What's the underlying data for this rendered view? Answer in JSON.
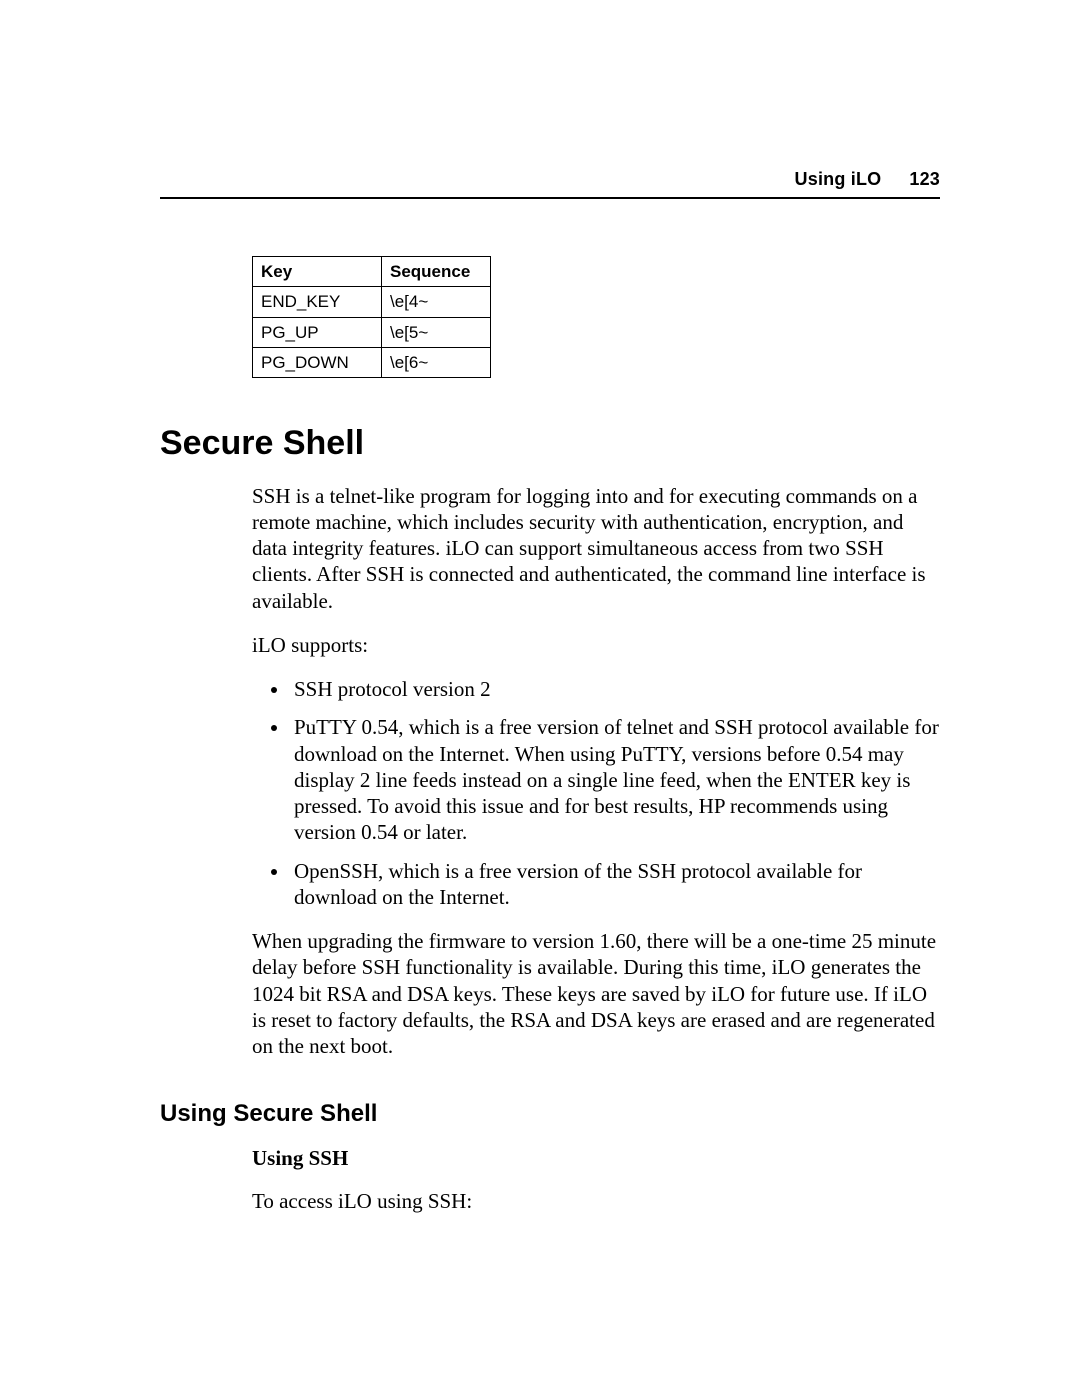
{
  "header": {
    "section": "Using iLO",
    "page_number": "123"
  },
  "table": {
    "headers": {
      "key": "Key",
      "sequence": "Sequence"
    },
    "rows": [
      {
        "key": "END_KEY",
        "sequence": "\\e[4~"
      },
      {
        "key": "PG_UP",
        "sequence": "\\e[5~"
      },
      {
        "key": "PG_DOWN",
        "sequence": "\\e[6~"
      }
    ]
  },
  "h1": "Secure Shell",
  "p1": "SSH is a telnet-like program for logging into and for executing commands on a remote machine, which includes security with authentication, encryption, and data integrity features. iLO can support simultaneous access from two SSH clients. After SSH is connected and authenticated, the command line interface is available.",
  "p2": "iLO supports:",
  "list": {
    "0": "SSH protocol version 2",
    "1": "PuTTY 0.54, which is a free version of telnet and SSH protocol available for download on the Internet. When using PuTTY, versions before 0.54 may display 2 line feeds instead on a single line feed, when the ENTER key is pressed. To avoid this issue and for best results, HP recommends using version 0.54 or later.",
    "2": "OpenSSH, which is a free version of the SSH protocol available for download on the Internet."
  },
  "p3": "When upgrading the firmware to version 1.60, there will be a one-time 25 minute delay before SSH functionality is available. During this time, iLO generates the 1024 bit RSA and DSA keys. These keys are saved by iLO for future use. If iLO is reset to factory defaults, the RSA and DSA keys are erased and are regenerated on the next boot.",
  "h2": "Using Secure Shell",
  "h3": "Using SSH",
  "p4": "To access iLO using SSH:"
}
